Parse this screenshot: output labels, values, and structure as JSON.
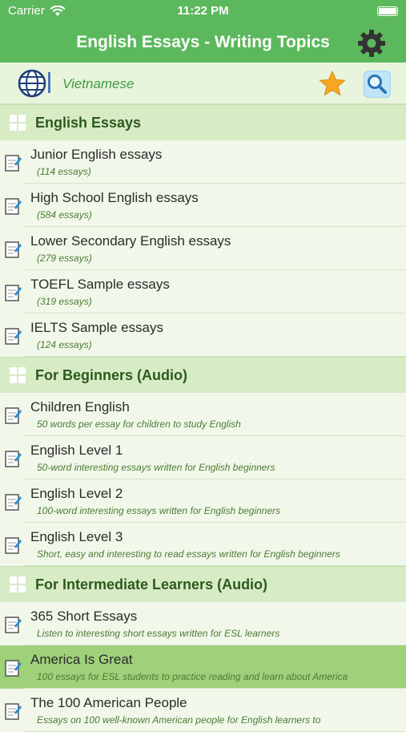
{
  "status": {
    "carrier": "Carrier",
    "time": "11:22 PM"
  },
  "nav": {
    "title": "English Essays - Writing Topics"
  },
  "lang": {
    "label": "Vietnamese"
  },
  "sections": [
    {
      "label": "English Essays",
      "items": [
        {
          "title": "Junior English essays",
          "sub": "(114 essays)"
        },
        {
          "title": "High School English essays",
          "sub": "(584 essays)"
        },
        {
          "title": "Lower Secondary English essays",
          "sub": "(279 essays)"
        },
        {
          "title": "TOEFL Sample essays",
          "sub": "(319 essays)"
        },
        {
          "title": "IELTS Sample essays",
          "sub": "(124 essays)"
        }
      ]
    },
    {
      "label": "For Beginners (Audio)",
      "items": [
        {
          "title": "Children English",
          "sub": "50 words per essay for children to study English"
        },
        {
          "title": "English Level 1",
          "sub": "50-word interesting essays written for English beginners"
        },
        {
          "title": "English Level 2",
          "sub": "100-word interesting essays written for English beginners"
        },
        {
          "title": "English Level 3",
          "sub": "Short, easy and interesting to read essays written for English beginners"
        }
      ]
    },
    {
      "label": "For Intermediate Learners (Audio)",
      "items": [
        {
          "title": "365 Short Essays",
          "sub": "Listen to interesting short essays written for ESL learners"
        },
        {
          "title": "America Is Great",
          "sub": "100 essays for ESL students to practice reading and learn about America"
        },
        {
          "title": "The 100 American People",
          "sub": "Essays on 100 well-known American people for English learners to"
        }
      ]
    }
  ]
}
